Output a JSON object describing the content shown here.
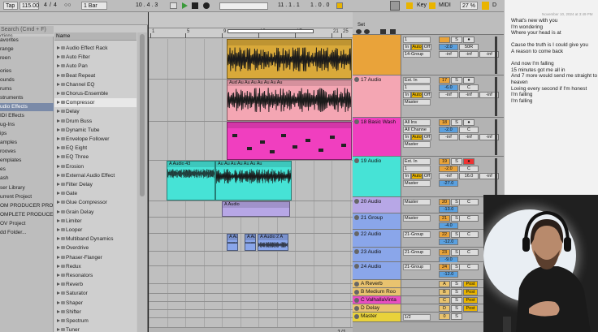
{
  "transport": {
    "tap": "Tap",
    "tempo": "115.00",
    "meter_a": "4",
    "meter_b": "4",
    "quant_circle": "○○",
    "quant_bar": "1 Bar",
    "position": "10 . 4 . 3",
    "loop_start": "11 . 1 . 1",
    "punch_in": "1 . 0 . 0",
    "key_label": "Key",
    "midi_label": "MIDI",
    "cpu": "27 %",
    "d_label": "D"
  },
  "browser": {
    "search_placeholder": "Search (Cmd + F)",
    "categories_header": "ctions",
    "name_header": "Name",
    "categories": [
      {
        "label": "avorites",
        "selected": false
      },
      {
        "label": "range",
        "selected": false
      },
      {
        "label": "reen",
        "selected": false
      },
      {
        "label": "ories",
        "selected": false
      },
      {
        "label": "ounds",
        "selected": false
      },
      {
        "label": "rums",
        "selected": false
      },
      {
        "label": "struments",
        "selected": false
      },
      {
        "label": "udio Effects",
        "selected": true
      },
      {
        "label": "IDI Effects",
        "selected": false
      },
      {
        "label": "ug-Ins",
        "selected": false
      },
      {
        "label": "ips",
        "selected": false
      },
      {
        "label": "amples",
        "selected": false
      },
      {
        "label": "rooves",
        "selected": false
      },
      {
        "label": "emplates",
        "selected": false
      },
      {
        "label": "es",
        "selected": false
      },
      {
        "label": "ash",
        "selected": false
      },
      {
        "label": "ser Library",
        "selected": false
      },
      {
        "label": "urrent Project",
        "selected": false
      },
      {
        "label": "OM PRODUCER PRO SAI",
        "selected": false
      },
      {
        "label": "OMPLETE PRODUCER PI",
        "selected": false
      },
      {
        "label": "OV Project",
        "selected": false
      },
      {
        "label": "dd Folder...",
        "selected": false
      }
    ],
    "files": [
      {
        "label": "Audio Effect Rack",
        "selected": false
      },
      {
        "label": "Auto Filter",
        "selected": false
      },
      {
        "label": "Auto Pan",
        "selected": false
      },
      {
        "label": "Beat Repeat",
        "selected": false
      },
      {
        "label": "Channel EQ",
        "selected": false
      },
      {
        "label": "Chorus-Ensemble",
        "selected": false
      },
      {
        "label": "Compressor",
        "selected": true
      },
      {
        "label": "Delay",
        "selected": false
      },
      {
        "label": "Drum Buss",
        "selected": false
      },
      {
        "label": "Dynamic Tube",
        "selected": false
      },
      {
        "label": "Envelope Follower",
        "selected": false
      },
      {
        "label": "EQ Eight",
        "selected": false
      },
      {
        "label": "EQ Three",
        "selected": false
      },
      {
        "label": "Erosion",
        "selected": false
      },
      {
        "label": "External Audio Effect",
        "selected": false
      },
      {
        "label": "Filter Delay",
        "selected": false
      },
      {
        "label": "Gate",
        "selected": false
      },
      {
        "label": "Glue Compressor",
        "selected": false
      },
      {
        "label": "Grain Delay",
        "selected": false
      },
      {
        "label": "Limiter",
        "selected": false
      },
      {
        "label": "Looper",
        "selected": false
      },
      {
        "label": "Multiband Dynamics",
        "selected": false
      },
      {
        "label": "Overdrive",
        "selected": false
      },
      {
        "label": "Phaser-Flanger",
        "selected": false
      },
      {
        "label": "Redux",
        "selected": false
      },
      {
        "label": "Resonators",
        "selected": false
      },
      {
        "label": "Reverb",
        "selected": false
      },
      {
        "label": "Saturator",
        "selected": false
      },
      {
        "label": "Shaper",
        "selected": false
      },
      {
        "label": "Shifter",
        "selected": false
      },
      {
        "label": "Spectrum",
        "selected": false
      },
      {
        "label": "Tuner",
        "selected": false
      }
    ]
  },
  "ruler": {
    "bars": [
      "1",
      "5",
      "9",
      "13",
      "17",
      "21",
      "25"
    ],
    "times": [
      "0:00",
      "0:10",
      "0:20",
      "0:30",
      "0:40"
    ],
    "page": "1/1"
  },
  "set_label": "Set",
  "clips": [
    {
      "label": "",
      "color": "#d9a93a"
    },
    {
      "label": "Aud Au Au Au Au Au Au Au",
      "color": "#f4a6b3"
    },
    {
      "label": "",
      "color": "#f03fbf"
    },
    {
      "label": "A Audio 43",
      "color": "#46e3d6"
    },
    {
      "label": "Au Au Au Au Au Au Au",
      "color": "#46e3d6"
    },
    {
      "label": "A Audio",
      "color": "#b7a7e6"
    },
    {
      "label": "A Audio 2 A",
      "color": "#8aa6ea"
    },
    {
      "label": "A Audio 2 A",
      "color": "#8aa6ea"
    },
    {
      "label": "A Audio 2 A",
      "color": "#8aa6ea"
    }
  ],
  "tracks": [
    {
      "name": "",
      "color": "#e9a33a",
      "input": "",
      "route_in": "1",
      "monitor": [
        "In",
        "Auto",
        "Off"
      ],
      "output": "14-Group",
      "vol": "-2.0",
      "pan": "50R",
      "send_a": "-inf",
      "send_b": "-inf",
      "send_c": "-inf",
      "num": ""
    },
    {
      "name": "17 Audio",
      "color": "#f4a6b3",
      "input": "Ext. In",
      "route_in": "1",
      "monitor": [
        "In",
        "Auto",
        "Off"
      ],
      "output": "Master",
      "vol": "-6.0",
      "pan": "C",
      "send_a": "-inf",
      "send_b": "-inf",
      "send_c": "-inf",
      "num": "17"
    },
    {
      "name": "18 Basic Wash",
      "color": "#f03fbf",
      "input": "All Ins",
      "route_in": "All Channe",
      "monitor": [
        "In",
        "Auto",
        "Off"
      ],
      "output": "Master",
      "vol": "-2.0",
      "pan": "C",
      "send_a": "-inf",
      "send_b": "-inf",
      "send_c": "-inf",
      "num": "18"
    },
    {
      "name": "19 Audio",
      "color": "#46e3d6",
      "input": "Ext. In",
      "route_in": "1",
      "monitor": [
        "In",
        "Auto",
        "Off"
      ],
      "output": "Master",
      "vol": "-2.0",
      "pan": "C",
      "send_a": "-inf",
      "send_b": "16.0",
      "send_c": "-inf",
      "extra": "-27.0",
      "num": "19"
    },
    {
      "name": "20 Audio",
      "color": "#b7a7e6",
      "output": "Master",
      "vol": "-13.0",
      "pan": "C",
      "num": "20"
    },
    {
      "name": "21 Group",
      "color": "#8aa6ea",
      "output": "Master",
      "vol": "-4.0",
      "pan": "C",
      "num": "21"
    },
    {
      "name": "22 Audio",
      "color": "#8aa6ea",
      "output": "21-Group",
      "vol": "-12.0",
      "pan": "C",
      "num": "22"
    },
    {
      "name": "23 Audio",
      "color": "#8aa6ea",
      "output": "21-Group",
      "vol": "-9.0",
      "pan": "C",
      "num": "23"
    },
    {
      "name": "24 Audio",
      "color": "#8aa6ea",
      "output": "21-Group",
      "vol": "-12.0",
      "pan": "C",
      "num": "24"
    }
  ],
  "returns": [
    {
      "name": "A Reverb",
      "color": "#e9c36f",
      "num": "A"
    },
    {
      "name": "B Medium Roo",
      "color": "#e9c36f",
      "num": "B"
    },
    {
      "name": "C ValhallaVinta",
      "color": "#e94fc1",
      "num": "C"
    },
    {
      "name": "D Delay",
      "color": "#e9c36f",
      "num": "D"
    },
    {
      "name": "Master",
      "color": "#e9d23a",
      "num": "0",
      "output": "1/2"
    }
  ],
  "return_labels": {
    "s": "S",
    "post": "Post"
  },
  "notes": {
    "date": "November 10, 2024 at 3:49 PM",
    "lines": [
      "What's new with you",
      "I'm wondering",
      "Where your head is at",
      "",
      "Cause the truth is I could give you",
      "A reason to come back",
      "",
      "And now I'm falling",
      "15 minutes got me all in",
      "And 7 more would send me straight to",
      "heaven",
      "Loving every second if I'm honest",
      "I'm falling",
      "I'm falling"
    ]
  }
}
